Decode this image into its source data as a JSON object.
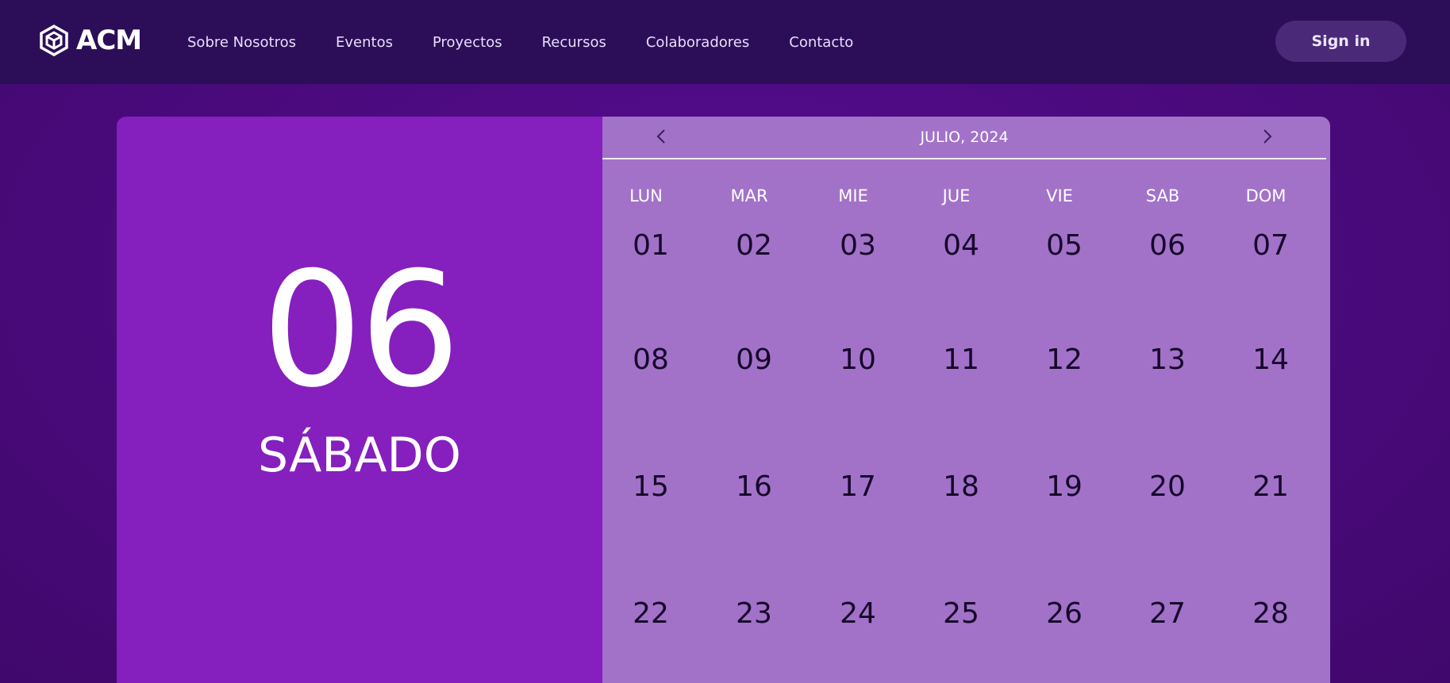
{
  "brand": {
    "name": "ACM"
  },
  "nav": {
    "links": [
      "Sobre Nosotros",
      "Eventos",
      "Proyectos",
      "Recursos",
      "Colaboradores",
      "Contacto"
    ],
    "signin_label": "Sign in"
  },
  "selected": {
    "day": "06",
    "weekday": "SÁBADO"
  },
  "calendar": {
    "month_label": "JULIO, 2024",
    "weekdays": [
      "LUN",
      "MAR",
      "MIE",
      "JUE",
      "VIE",
      "SAB",
      "DOM"
    ],
    "weeks": [
      [
        "01",
        "02",
        "03",
        "04",
        "05",
        "06",
        "07"
      ],
      [
        "08",
        "09",
        "10",
        "11",
        "12",
        "13",
        "14"
      ],
      [
        "15",
        "16",
        "17",
        "18",
        "19",
        "20",
        "21"
      ],
      [
        "22",
        "23",
        "24",
        "25",
        "26",
        "27",
        "28"
      ]
    ]
  },
  "colors": {
    "nav_bg": "#2c0e58",
    "page_bg": "#4b0b7e",
    "left_panel": "#851fbd",
    "right_panel": "#a272c9",
    "signin_bg": "#4a2a78"
  },
  "icons": {
    "logo": "hexagon-cube-icon",
    "prev": "chevron-left-icon",
    "next": "chevron-right-icon"
  }
}
